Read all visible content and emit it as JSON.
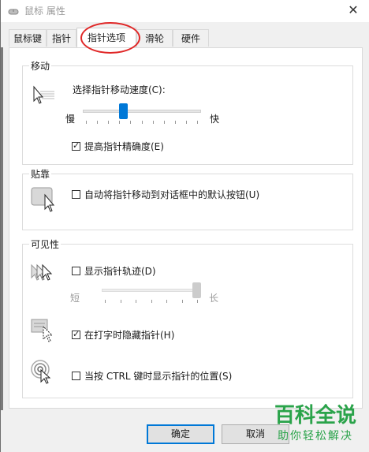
{
  "window": {
    "title": "鼠标 属性",
    "close_glyph": "✕"
  },
  "tabs": [
    {
      "label": "鼠标键"
    },
    {
      "label": "指针"
    },
    {
      "label": "指针选项"
    },
    {
      "label": "滑轮"
    },
    {
      "label": "硬件"
    }
  ],
  "active_tab": "指针选项",
  "motion": {
    "title": "移动",
    "speed_label": "选择指针移动速度(C):",
    "slow_label": "慢",
    "fast_label": "快",
    "speed_fraction": 0.33,
    "enhance_precision_label": "提高指针精确度(E)",
    "enhance_precision_checked": true
  },
  "snap": {
    "title": "贴靠",
    "snap_label": "自动将指针移动到对话框中的默认按钮(U)",
    "snap_checked": false
  },
  "visibility": {
    "title": "可见性",
    "trails_label": "显示指针轨迹(D)",
    "trails_checked": false,
    "short_label": "短",
    "long_label": "长",
    "trails_fraction": 1.0,
    "hide_typing_label": "在打字时隐藏指针(H)",
    "hide_typing_checked": true,
    "ctrl_label": "当按 CTRL 键时显示指针的位置(S)",
    "ctrl_checked": false
  },
  "buttons": {
    "ok": "确定",
    "cancel": "取消"
  },
  "watermark": {
    "main": "百科全说",
    "sub": "助你轻松解决"
  },
  "colors": {
    "accent": "#0078d7",
    "highlight_circle": "#e02626",
    "watermark": "#2aa34a"
  }
}
